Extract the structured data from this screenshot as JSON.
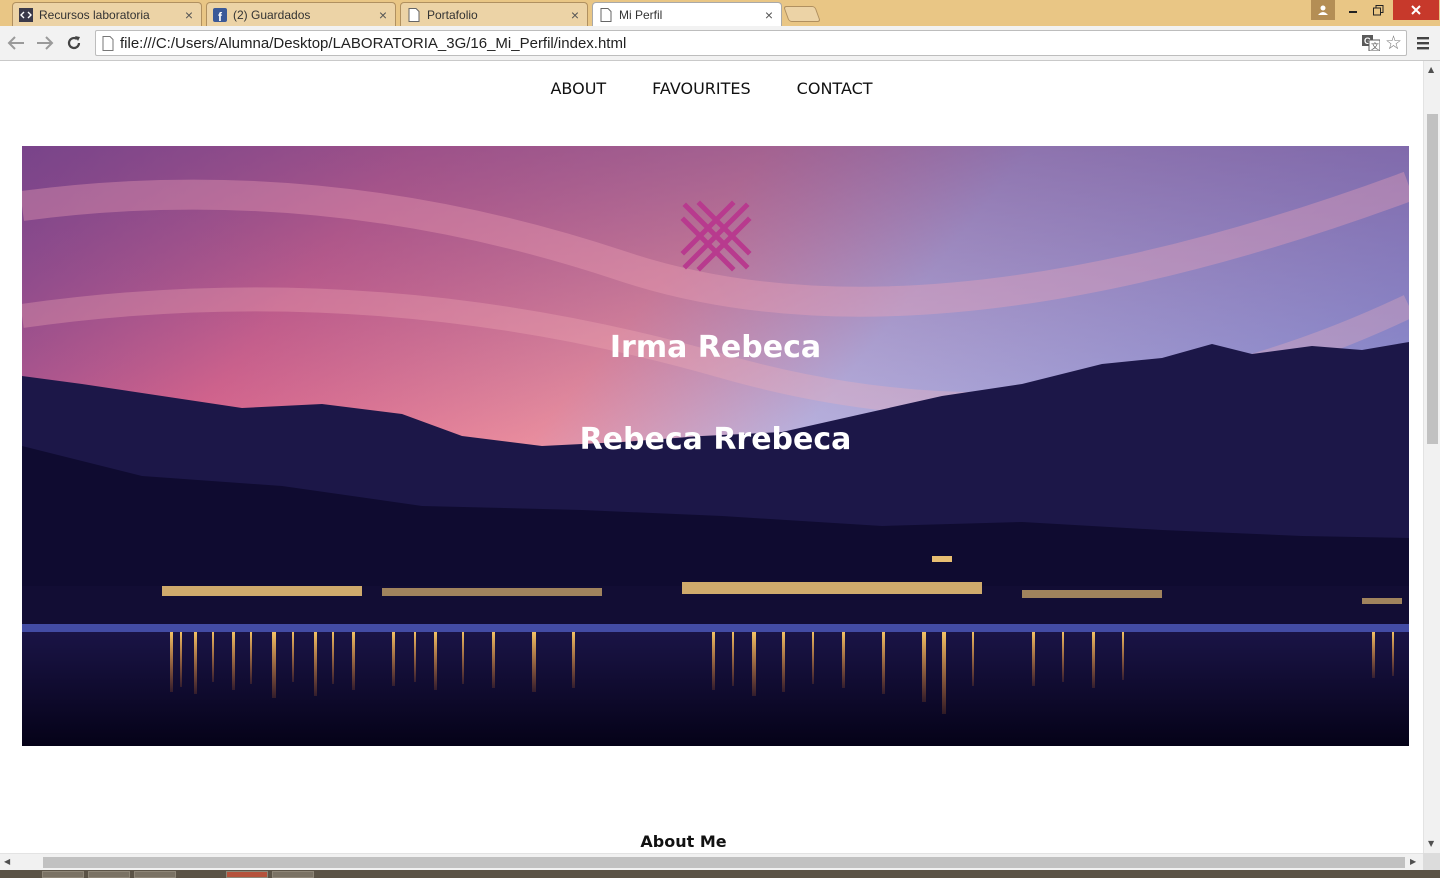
{
  "browser": {
    "tabs": [
      {
        "label": "Recursos laboratoria",
        "icon": "code-icon",
        "active": false
      },
      {
        "label": "(2) Guardados",
        "icon": "facebook-icon",
        "active": false
      },
      {
        "label": "Portafolio",
        "icon": "page-icon",
        "active": false
      },
      {
        "label": "Mi Perfil",
        "icon": "page-icon",
        "active": true
      }
    ],
    "close_glyph": "×",
    "url": "file:///C:/Users/Alumna/Desktop/LABORATORIA_3G/16_Mi_Perfil/index.html"
  },
  "nav": {
    "items": [
      "ABOUT",
      "FAVOURITES",
      "CONTACT"
    ]
  },
  "hero": {
    "logo_color": "#b83a8e",
    "name_line1": "Irma Rebeca",
    "name_line2": "Rebeca Rrebeca"
  },
  "sections": {
    "about_title": "About Me"
  }
}
